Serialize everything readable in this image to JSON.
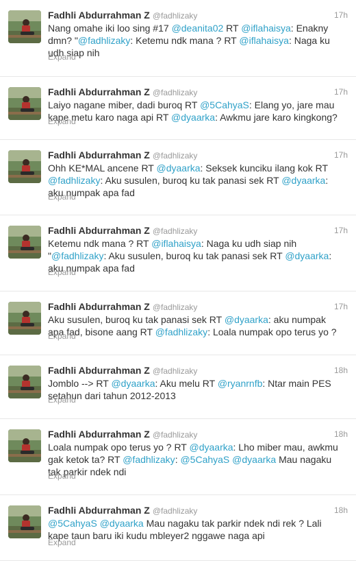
{
  "tweets": [
    {
      "fullname": "Fadhli Abdurrahman Z",
      "username": "@fadhlizaky",
      "time": "17h",
      "expand": "Expand",
      "segments": [
        {
          "t": "Nang omahe iki loo sing #17 "
        },
        {
          "t": "@deanita02",
          "link": true
        },
        {
          "t": " RT "
        },
        {
          "t": "@iflahaisya",
          "link": true
        },
        {
          "t": ": Enakny\ndmn? \""
        },
        {
          "t": "@fadhlizaky",
          "link": true
        },
        {
          "t": ": Ketemu ndk mana ? RT "
        },
        {
          "t": "@iflahaisya",
          "link": true
        },
        {
          "t": ": Naga ku\nudh siap nih"
        }
      ]
    },
    {
      "fullname": "Fadhli Abdurrahman Z",
      "username": "@fadhlizaky",
      "time": "17h",
      "expand": "Expand",
      "segments": [
        {
          "t": "Laiyo nagane miber, dadi buroq RT "
        },
        {
          "t": "@5CahyaS",
          "link": true
        },
        {
          "t": ": Elang yo, jare mau\nkape metu karo naga api RT "
        },
        {
          "t": "@dyaarka",
          "link": true
        },
        {
          "t": ": Awkmu jare karo kingkong?"
        }
      ]
    },
    {
      "fullname": "Fadhli Abdurrahman Z",
      "username": "@fadhlizaky",
      "time": "17h",
      "expand": "Expand",
      "segments": [
        {
          "t": "Ohh KE*MAL ancene RT "
        },
        {
          "t": "@dyaarka",
          "link": true
        },
        {
          "t": ": Seksek kunciku ilang kok RT\n"
        },
        {
          "t": "@fadhlizaky",
          "link": true
        },
        {
          "t": ": Aku susulen, buroq ku tak panasi sek RT "
        },
        {
          "t": "@dyaarka",
          "link": true
        },
        {
          "t": ":\naku numpak apa fad"
        }
      ]
    },
    {
      "fullname": "Fadhli Abdurrahman Z",
      "username": "@fadhlizaky",
      "time": "17h",
      "expand": "Expand",
      "segments": [
        {
          "t": "Ketemu ndk mana ? RT "
        },
        {
          "t": "@iflahaisya",
          "link": true
        },
        {
          "t": ": Naga ku udh siap nih\n\""
        },
        {
          "t": "@fadhlizaky",
          "link": true
        },
        {
          "t": ": Aku susulen, buroq ku tak panasi sek RT "
        },
        {
          "t": "@dyaarka",
          "link": true
        },
        {
          "t": ":\naku numpak apa fad"
        }
      ]
    },
    {
      "fullname": "Fadhli Abdurrahman Z",
      "username": "@fadhlizaky",
      "time": "17h",
      "expand": "Expand",
      "segments": [
        {
          "t": "Aku susulen, buroq ku tak panasi sek RT "
        },
        {
          "t": "@dyaarka",
          "link": true
        },
        {
          "t": ": aku numpak\napa fad, bisone aang RT "
        },
        {
          "t": "@fadhlizaky",
          "link": true
        },
        {
          "t": ": Loala numpak opo terus yo ?"
        }
      ]
    },
    {
      "fullname": "Fadhli Abdurrahman Z",
      "username": "@fadhlizaky",
      "time": "18h",
      "expand": "Expand",
      "segments": [
        {
          "t": "Jomblo --> RT "
        },
        {
          "t": "@dyaarka",
          "link": true
        },
        {
          "t": ": Aku melu RT "
        },
        {
          "t": "@ryanrnfb",
          "link": true
        },
        {
          "t": ": Ntar main PES\nsetahun dari tahun 2012-2013"
        }
      ]
    },
    {
      "fullname": "Fadhli Abdurrahman Z",
      "username": "@fadhlizaky",
      "time": "18h",
      "expand": "Expand",
      "segments": [
        {
          "t": "Loala numpak opo terus yo ? RT "
        },
        {
          "t": "@dyaarka",
          "link": true
        },
        {
          "t": ": Lho miber mau, awkmu\ngak ketok ta? RT "
        },
        {
          "t": "@fadhlizaky",
          "link": true
        },
        {
          "t": ": "
        },
        {
          "t": "@5CahyaS",
          "link": true
        },
        {
          "t": " "
        },
        {
          "t": "@dyaarka",
          "link": true
        },
        {
          "t": " Mau nagaku\ntak parkir ndek ndi"
        }
      ]
    },
    {
      "fullname": "Fadhli Abdurrahman Z",
      "username": "@fadhlizaky",
      "time": "18h",
      "expand": "Expand",
      "segments": [
        {
          "t": "@5CahyaS",
          "link": true
        },
        {
          "t": " "
        },
        {
          "t": "@dyaarka",
          "link": true
        },
        {
          "t": " Mau nagaku tak parkir ndek ndi rek ? Lali\nkape taun baru iki kudu mbleyer2 nggawe naga api"
        }
      ]
    }
  ]
}
